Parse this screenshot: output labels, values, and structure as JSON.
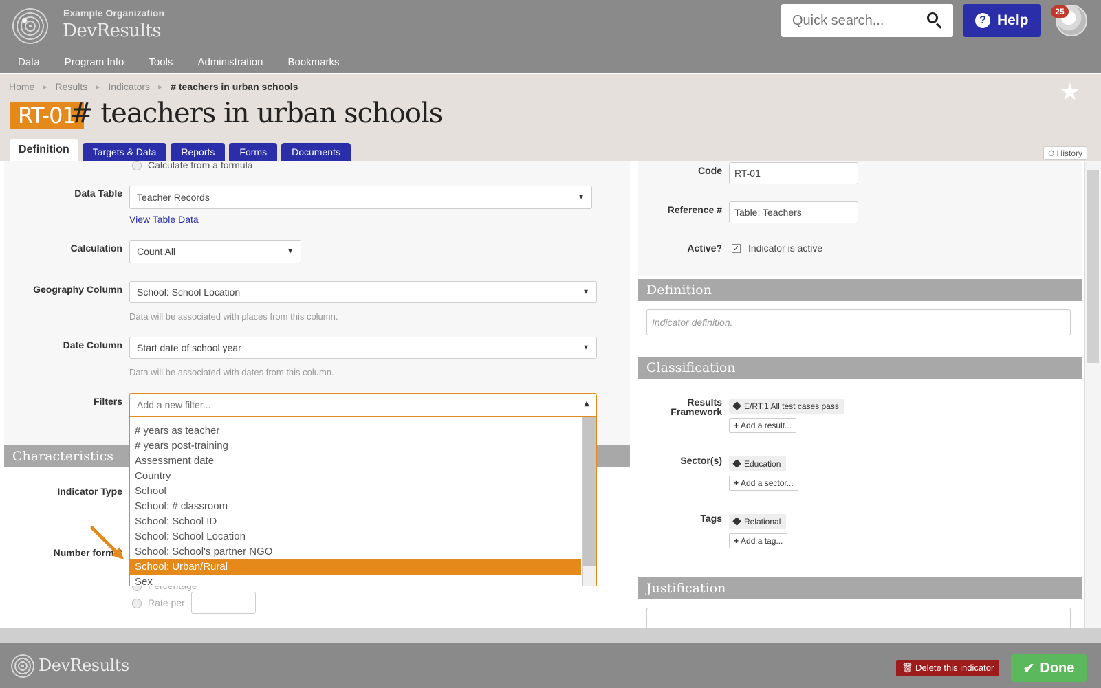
{
  "header": {
    "org_name": "Example Organization",
    "app_name": "DevResults",
    "search_placeholder": "Quick search...",
    "help_label": "Help",
    "notifications_count": "25",
    "nav": [
      "Data",
      "Program Info",
      "Tools",
      "Administration",
      "Bookmarks"
    ]
  },
  "breadcrumb": {
    "items": [
      "Home",
      "Results",
      "Indicators"
    ],
    "current": "# teachers in urban schools"
  },
  "page": {
    "code_badge": "RT-01",
    "title": "# teachers in urban schools",
    "tabs": [
      "Definition",
      "Targets & Data",
      "Reports",
      "Forms",
      "Documents"
    ],
    "active_tab": "Definition",
    "history_label": "History"
  },
  "form": {
    "calc_formula_label": "Calculate from a formula",
    "data_table": {
      "label": "Data Table",
      "value": "Teacher Records",
      "link": "View Table Data"
    },
    "calculation": {
      "label": "Calculation",
      "value": "Count All"
    },
    "geography": {
      "label": "Geography Column",
      "value": "School: School Location",
      "help": "Data will be associated with places from this column."
    },
    "date": {
      "label": "Date Column",
      "value": "Start date of school year",
      "help": "Data will be associated with dates from this column."
    },
    "filters": {
      "label": "Filters",
      "placeholder": "Add a new filter...",
      "options": [
        "# years as teacher",
        "# years post-training",
        "Assessment date",
        "Country",
        "School",
        "School: # classroom",
        "School: School ID",
        "School: School Location",
        "School: School's partner NGO",
        "School: Urban/Rural",
        "Sex"
      ],
      "highlighted": "School: Urban/Rural"
    },
    "characteristics_title": "Characteristics",
    "indicator_type_label": "Indicator Type",
    "number_format_label": "Number format",
    "percentage_label": "Percentage",
    "rate_per_label": "Rate per"
  },
  "right": {
    "code": {
      "label": "Code",
      "value": "RT-01"
    },
    "reference": {
      "label": "Reference #",
      "value": "Table: Teachers"
    },
    "active": {
      "label": "Active?",
      "text": "Indicator is active",
      "checked": true
    },
    "definition": {
      "title": "Definition",
      "placeholder": "Indicator definition."
    },
    "classification": {
      "title": "Classification",
      "results_framework_label": "Results Framework",
      "results_framework_tag": "E/RT.1 All test cases pass",
      "add_result": "Add a result...",
      "sectors_label": "Sector(s)",
      "sector_tag": "Education",
      "add_sector": "Add a sector...",
      "tags_label": "Tags",
      "tag": "Relational",
      "add_tag": "Add a tag..."
    },
    "justification_title": "Justification"
  },
  "footer": {
    "app_name": "DevResults",
    "delete_label": "Delete this indicator",
    "done_label": "Done"
  },
  "colors": {
    "header_bg": "#8a8a8a",
    "accent_orange": "#e5891a",
    "nav_blue": "#2a2fa9",
    "done_green": "#5cb85c",
    "delete_red": "#9e1b1b"
  },
  "icons": [
    "search-icon",
    "help-icon",
    "star-icon",
    "history-icon",
    "tag-icon",
    "plus-icon",
    "trash-icon",
    "check-icon"
  ]
}
